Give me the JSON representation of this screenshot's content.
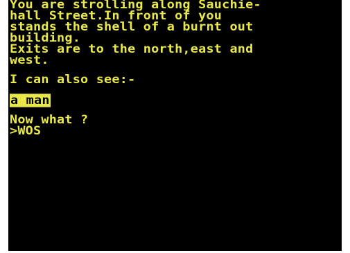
{
  "game": {
    "description_lines": [
      "You are strolling along Sauchie-",
      "hall Street.In front of you",
      "stands the shell of a burnt out",
      "building.",
      "Exits are to the north,east and",
      "west."
    ],
    "see_heading": "I can also see:-",
    "objects": [
      "a man"
    ],
    "prompt_question": "Now what ?",
    "prompt_symbol": ">",
    "command_input": "WOS"
  },
  "colors": {
    "background": "#000000",
    "text": "#e8e84a",
    "border": "#ffffff"
  }
}
